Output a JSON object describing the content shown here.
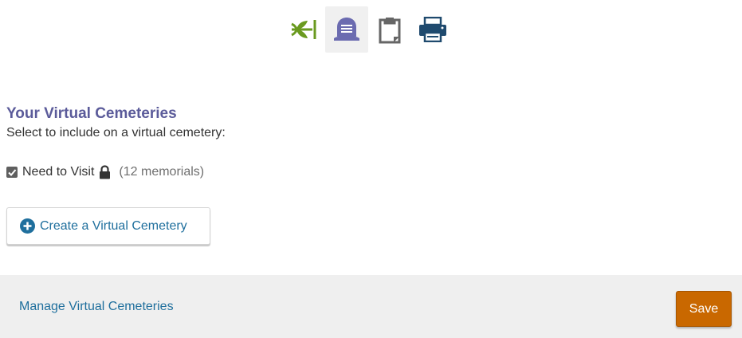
{
  "toolbar": {
    "items": [
      {
        "name": "leaf-icon",
        "color": "#6a9a1f",
        "active": false
      },
      {
        "name": "headstone-icon",
        "color": "#6b6bb0",
        "active": true
      },
      {
        "name": "clipboard-icon",
        "color": "#666666",
        "active": false
      },
      {
        "name": "printer-icon",
        "color": "#1f4a6e",
        "active": false
      }
    ]
  },
  "virtual_cemeteries": {
    "title": "Your Virtual Cemeteries",
    "subtitle": "Select to include on a virtual cemetery:",
    "items": [
      {
        "name": "Need to Visit",
        "count_label": "(12 memorials)",
        "checked": true,
        "private": true
      }
    ],
    "create_label": "Create a Virtual Cemetery"
  },
  "footer": {
    "manage_label": "Manage Virtual Cemeteries",
    "save_label": "Save"
  },
  "colors": {
    "title": "#5b5b9a",
    "link": "#1f6f9d",
    "save": "#c96800",
    "footer_bg": "#efefef"
  }
}
